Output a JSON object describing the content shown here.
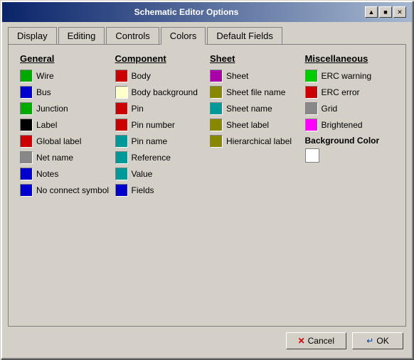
{
  "window": {
    "title": "Schematic Editor Options"
  },
  "titlebar_buttons": [
    "▲",
    "■",
    "✕"
  ],
  "tabs": [
    {
      "label": "Display",
      "active": false
    },
    {
      "label": "Editing",
      "active": false
    },
    {
      "label": "Controls",
      "active": false
    },
    {
      "label": "Colors",
      "active": true
    },
    {
      "label": "Default Fields",
      "active": false
    }
  ],
  "columns": {
    "general": {
      "header": "General",
      "items": [
        {
          "label": "Wire",
          "color": "#00aa00"
        },
        {
          "label": "Bus",
          "color": "#0000cc"
        },
        {
          "label": "Junction",
          "color": "#00aa00"
        },
        {
          "label": "Label",
          "color": "#000000"
        },
        {
          "label": "Global label",
          "color": "#cc0000"
        },
        {
          "label": "Net name",
          "color": "#888888"
        },
        {
          "label": "Notes",
          "color": "#0000cc"
        },
        {
          "label": "No connect symbol",
          "color": "#0000cc"
        }
      ]
    },
    "component": {
      "header": "Component",
      "items": [
        {
          "label": "Body",
          "color": "#cc0000"
        },
        {
          "label": "Body background",
          "color": "#ffffcc"
        },
        {
          "label": "Pin",
          "color": "#cc0000"
        },
        {
          "label": "Pin number",
          "color": "#cc0000"
        },
        {
          "label": "Pin name",
          "color": "#009999"
        },
        {
          "label": "Reference",
          "color": "#009999"
        },
        {
          "label": "Value",
          "color": "#009999"
        },
        {
          "label": "Fields",
          "color": "#0000cc"
        }
      ]
    },
    "sheet": {
      "header": "Sheet",
      "items": [
        {
          "label": "Sheet",
          "color": "#aa00aa"
        },
        {
          "label": "Sheet file name",
          "color": "#888800"
        },
        {
          "label": "Sheet name",
          "color": "#009999"
        },
        {
          "label": "Sheet label",
          "color": "#888800"
        },
        {
          "label": "Hierarchical label",
          "color": "#888800"
        }
      ]
    },
    "miscellaneous": {
      "header": "Miscellaneous",
      "items": [
        {
          "label": "ERC warning",
          "color": "#00cc00"
        },
        {
          "label": "ERC error",
          "color": "#cc0000"
        },
        {
          "label": "Grid",
          "color": "#888888"
        },
        {
          "label": "Brightened",
          "color": "#ff00ff"
        }
      ],
      "background_color": {
        "label": "Background Color",
        "color": "#ffffff"
      }
    }
  },
  "footer": {
    "cancel_label": "Cancel",
    "ok_label": "OK"
  }
}
